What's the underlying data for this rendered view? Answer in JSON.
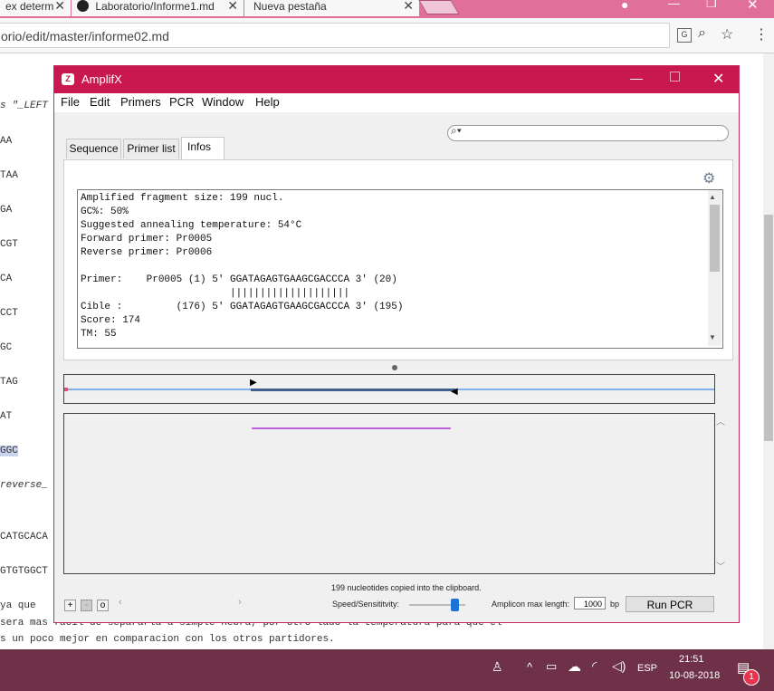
{
  "browser": {
    "tabs": [
      {
        "label": "ex determ"
      },
      {
        "label": "Laboratorio/Informe1.md"
      },
      {
        "label": "Nueva pestaña"
      }
    ],
    "url": "orio/edit/master/informe02.md"
  },
  "background_page": {
    "lines": [
      {
        "text": "s \"_LEFT"
      },
      {
        "text": "AA"
      },
      {
        "text": "TAA"
      },
      {
        "text": "GA"
      },
      {
        "text": "CGT"
      },
      {
        "text": "CA"
      },
      {
        "text": "CCT"
      },
      {
        "text": "GC"
      },
      {
        "text": "TAG"
      },
      {
        "text": "AT"
      },
      {
        "text": "GGC"
      },
      {
        "text": "reverse_"
      },
      {
        "text": "CATGCACA"
      },
      {
        "text": "GTGTGGCT"
      },
      {
        "text": " ya que"
      },
      {
        "text": " sera mas facil de separarla a simple hebra, por otro lado la temperatura para que el"
      },
      {
        "text": "s un poco mejor en comparacion con los otros partidores."
      }
    ]
  },
  "window": {
    "title": "AmplifX",
    "menu": [
      "File",
      "Edit",
      "Primers",
      "PCR",
      "Window",
      "Help"
    ],
    "tabs": [
      "Sequence",
      "Primer list",
      "Infos"
    ],
    "active_tab": "Infos",
    "search_placeholder": "",
    "info_lines": [
      "Amplified fragment size: 199 nucl.",
      "GC%: 50%",
      "Suggested annealing temperature: 54°C",
      "Forward primer: Pr0005",
      "Reverse primer: Pr0006",
      "",
      "Primer:    Pr0005 (1) 5' GGATAGAGTGAAGCGACCCA 3' (20)",
      "                         ||||||||||||||||||||",
      "Cible :         (176) 5' GGATAGAGTGAAGCGACCCA 3' (195)",
      "Score: 174",
      "TM: 55"
    ],
    "status": "199 nucleotides copied into the clipboard.",
    "speed_label": "Speed/Sensititvity:",
    "speed_value": 0.8,
    "amplicon_label": "Amplicon max length:",
    "amplicon_value": "1000",
    "amplicon_unit": "bp",
    "run_button": "Run PCR",
    "buttons": {
      "add": "+",
      "remove": "-",
      "other": "o"
    }
  },
  "taskbar": {
    "lang": "ESP",
    "time": "21:51",
    "date": "10-08-2018",
    "notifications": "1"
  },
  "colors": {
    "title_bar": "#c8184f",
    "tabstrip": "#e0709a",
    "taskbar": "#6e3148",
    "amplicon_line": "#c060e0"
  }
}
